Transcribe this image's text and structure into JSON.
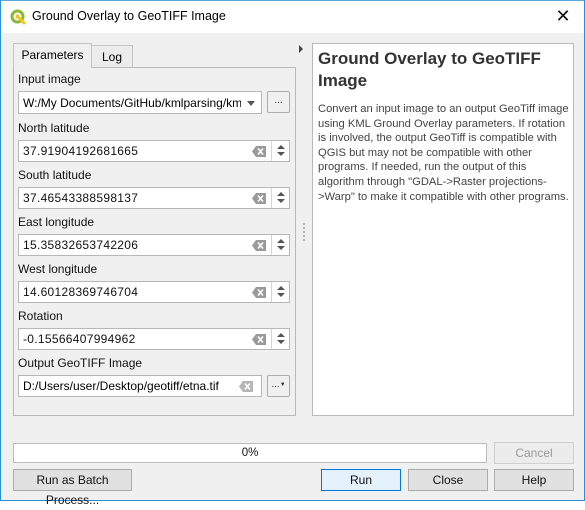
{
  "window": {
    "title": "Ground Overlay to GeoTIFF Image",
    "close_glyph": "✕"
  },
  "tabs": [
    {
      "label": "Parameters",
      "active": true
    },
    {
      "label": "Log",
      "active": false
    }
  ],
  "parameters": {
    "input_image": {
      "label": "Input image",
      "value": "W:/My Documents/GitHub/kmlparsing/kml-sar",
      "browse_label": "..."
    },
    "north_latitude": {
      "label": "North latitude",
      "value": "37.91904192681665"
    },
    "south_latitude": {
      "label": "South latitude",
      "value": "37.46543388598137"
    },
    "east_longitude": {
      "label": "East longitude",
      "value": "15.35832653742206"
    },
    "west_longitude": {
      "label": "West longitude",
      "value": "14.60128369746704"
    },
    "rotation": {
      "label": "Rotation",
      "value": "-0.15566407994962"
    },
    "output": {
      "label": "Output GeoTIFF Image",
      "value": "D:/Users/user/Desktop/geotiff/etna.tif",
      "browse_label": "..."
    }
  },
  "help": {
    "title": "Ground Overlay to GeoTIFF Image",
    "body": "Convert an input image to an output GeoTiff image using KML Ground Overlay parameters. If rotation is involved, the output GeoTiff is compatible with QGIS but may not be compatible with other programs. If needed, run the output of this algorithm through \"GDAL->Raster projections->Warp\" to make it compatible with other programs."
  },
  "progress": {
    "value": 0,
    "label": "0%"
  },
  "buttons": {
    "cancel": "Cancel",
    "batch": "Run as Batch Process...",
    "run": "Run",
    "close": "Close",
    "help": "Help"
  },
  "colors": {
    "accent": "#0078d7",
    "window_border": "#2b8fd6",
    "qgis_green": "#8ab833",
    "qgis_yellow": "#f0c419"
  }
}
